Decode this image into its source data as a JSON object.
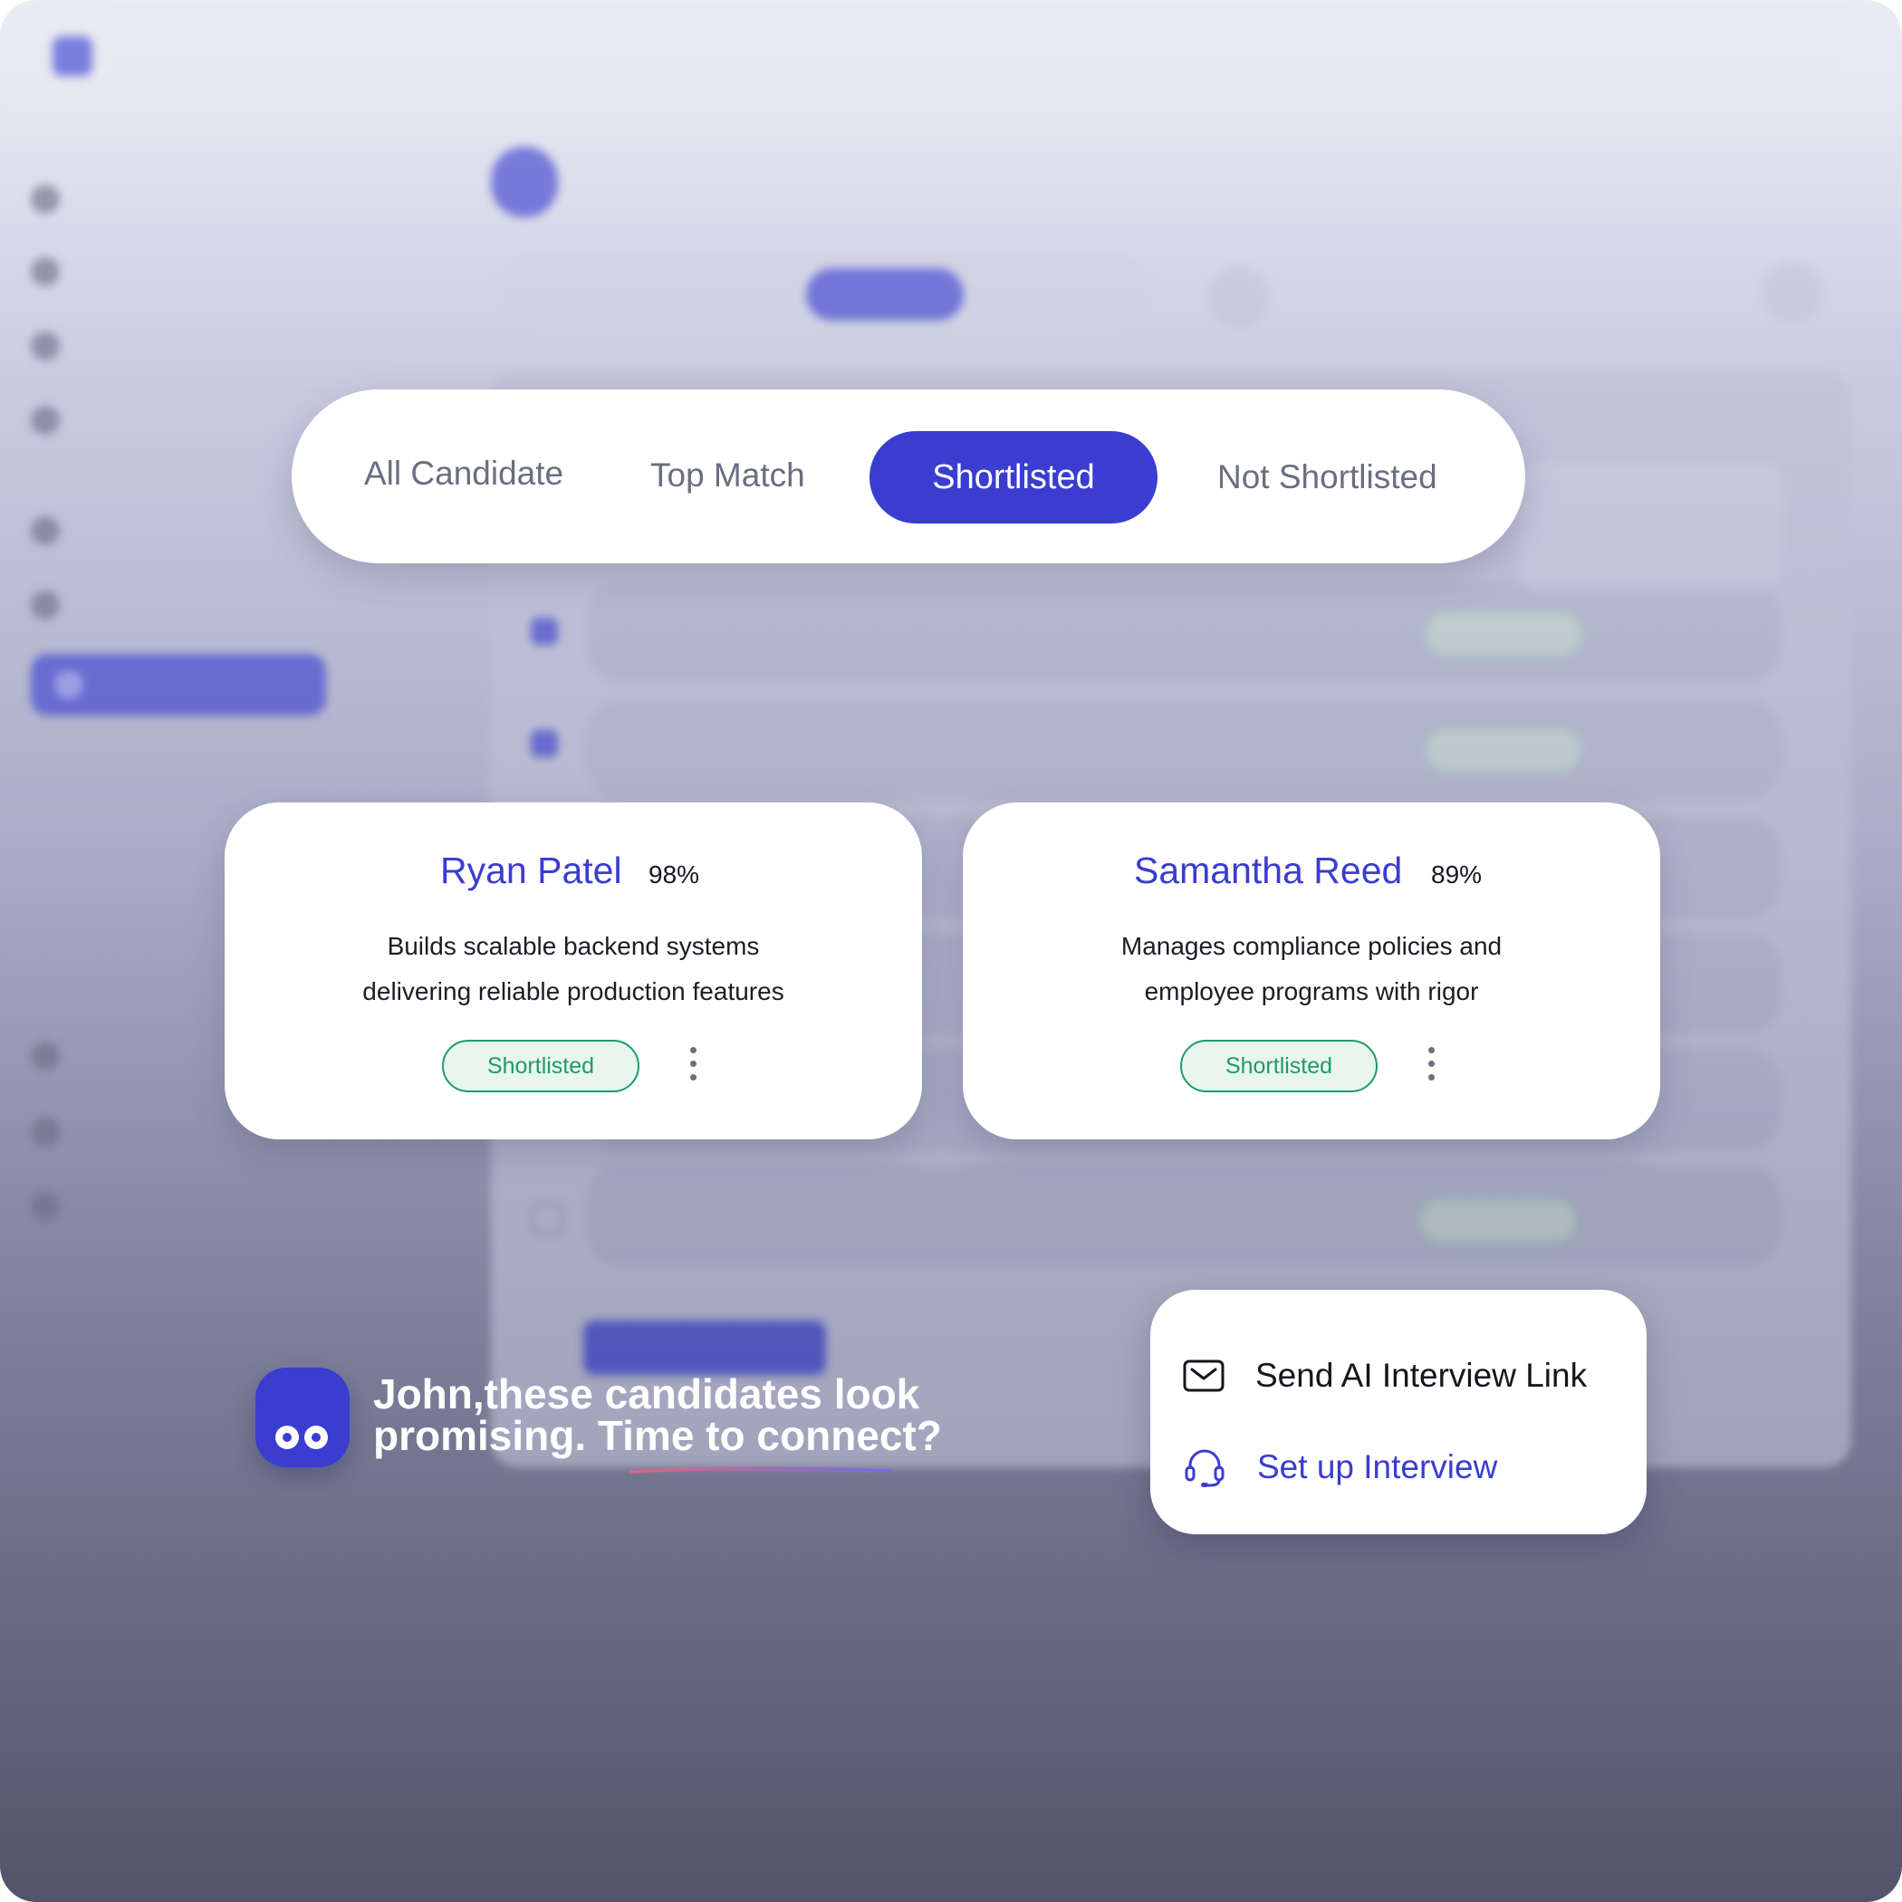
{
  "header": {
    "message_line1": "John,these candidates look",
    "message_line2": "promising. Time to connect?"
  },
  "tabs": [
    {
      "label": "All Candidate",
      "active": false
    },
    {
      "label": "Top Match",
      "active": false
    },
    {
      "label": "Shortlisted",
      "active": true
    },
    {
      "label": "Not Shortlisted",
      "active": false
    }
  ],
  "candidates": [
    {
      "name": "Ryan Patel",
      "match": "98%",
      "desc_line1": "Builds scalable backend systems",
      "desc_line2": "delivering reliable production features",
      "status": "Shortlisted"
    },
    {
      "name": "Samantha Reed",
      "match": "89%",
      "desc_line1": "Manages compliance policies and",
      "desc_line2": "employee programs with rigor",
      "status": "Shortlisted"
    }
  ],
  "actions_menu": [
    {
      "label": "Send AI Interview Link",
      "icon": "mail-icon"
    },
    {
      "label": "Set up Interview",
      "icon": "headset-icon"
    }
  ],
  "colors": {
    "accent": "#3a3dd0",
    "badge_green": "#1f9a6b",
    "badge_bg": "#e8f6ef"
  }
}
